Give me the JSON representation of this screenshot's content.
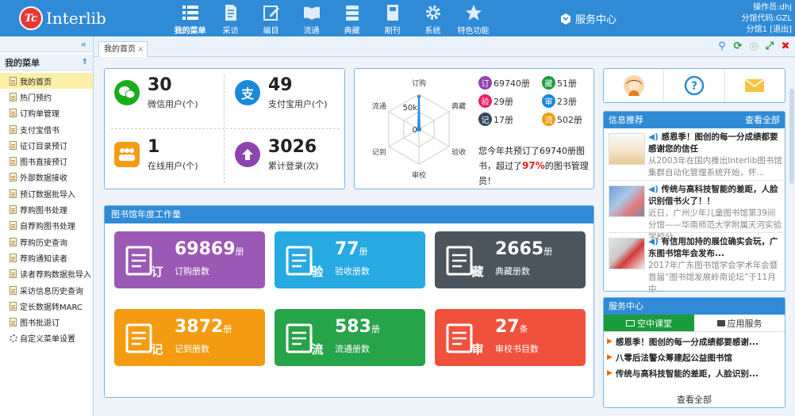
{
  "app": {
    "logo_mark": "Tc",
    "name": "Interlib"
  },
  "nav": [
    {
      "label": "我的菜单",
      "icon": "menu-list-icon",
      "active": true
    },
    {
      "label": "采访",
      "icon": "document-icon"
    },
    {
      "label": "编目",
      "icon": "edit-icon"
    },
    {
      "label": "流通",
      "icon": "book-open-icon"
    },
    {
      "label": "典藏",
      "icon": "archive-icon"
    },
    {
      "label": "期刊",
      "icon": "journal-icon"
    },
    {
      "label": "系统",
      "icon": "gear-icon"
    },
    {
      "label": "特色功能",
      "icon": "star-icon"
    }
  ],
  "service_center": "服务中心",
  "user": {
    "operator": "操作员:dhj",
    "branch_code": "分馆代码:GZL",
    "branch": "分馆1 [退出]"
  },
  "sidebar": {
    "collapse": "«",
    "title": "我的菜单",
    "toggle": "⇑",
    "items": [
      {
        "label": "我的首页",
        "active": true
      },
      {
        "label": "热门预约"
      },
      {
        "label": "订购单管理"
      },
      {
        "label": "支付宝借书"
      },
      {
        "label": "征订目录预订"
      },
      {
        "label": "图书直接预订"
      },
      {
        "label": "外部数据接收"
      },
      {
        "label": "预订数据批导入"
      },
      {
        "label": "荐购图书处理"
      },
      {
        "label": "自荐购图书处理"
      },
      {
        "label": "荐购历史查询"
      },
      {
        "label": "荐购通知读者"
      },
      {
        "label": "读者荐购数据批导入"
      },
      {
        "label": "采访信息历史查询"
      },
      {
        "label": "定长数据转MARC"
      },
      {
        "label": "图书批退订"
      },
      {
        "label": "自定义菜单设置",
        "icon": "gear"
      }
    ]
  },
  "tabs": [
    {
      "label": "我的首页",
      "close": "×"
    }
  ],
  "stats": [
    {
      "value": "30",
      "label": "微信用户(个)",
      "color": "#1aad19",
      "icon": "wechat-icon"
    },
    {
      "value": "49",
      "label": "支付宝用户(个)",
      "color": "#1a8ad8",
      "icon": "alipay-icon"
    },
    {
      "value": "1",
      "label": "在线用户(个)",
      "color": "#f39c12",
      "icon": "users-icon"
    },
    {
      "value": "3026",
      "label": "累计登录(次)",
      "color": "#8e44ad",
      "icon": "up-arrow-icon"
    }
  ],
  "radar": {
    "axes": [
      "订购",
      "典藏",
      "验收",
      "审校",
      "记到",
      "流通"
    ],
    "tick_labels": [
      "50k",
      "0"
    ],
    "values": [
      69740,
      51,
      29,
      23,
      17,
      502
    ]
  },
  "legend": [
    {
      "badge": "订",
      "value": "69740册",
      "color": "#8e44ad"
    },
    {
      "badge": "藏",
      "value": "51册",
      "color": "#1a9b3c"
    },
    {
      "badge": "验",
      "value": "29册",
      "color": "#e91e63"
    },
    {
      "badge": "审",
      "value": "23册",
      "color": "#1a8ad8"
    },
    {
      "badge": "记",
      "value": "17册",
      "color": "#34495e"
    },
    {
      "badge": "流",
      "value": "502册",
      "color": "#f39c12"
    }
  ],
  "summary": {
    "before": "您今年共预订了69740册图书，超过了",
    "pct": "97%",
    "after": "的图书管理员！"
  },
  "workload": {
    "title": "图书馆年度工作量",
    "tiles": [
      {
        "value": "69869",
        "unit": "册",
        "label": "订购册数",
        "color": "#9b59b6",
        "icon": "books-order-icon"
      },
      {
        "value": "77",
        "unit": "册",
        "label": "验收册数",
        "color": "#27a9e1",
        "icon": "chart-check-icon"
      },
      {
        "value": "2665",
        "unit": "册",
        "label": "典藏册数",
        "color": "#4a555d",
        "icon": "archive-doc-icon"
      },
      {
        "value": "3872",
        "unit": "册",
        "label": "记到册数",
        "color": "#f39c12",
        "icon": "book-record-icon"
      },
      {
        "value": "583",
        "unit": "册",
        "label": "流通册数",
        "color": "#27a34a",
        "icon": "globe-book-icon"
      },
      {
        "value": "27",
        "unit": "条",
        "label": "审校书目数",
        "color": "#f0513c",
        "icon": "review-icon"
      }
    ]
  },
  "quick_icons": [
    "avatar-icon",
    "help-icon",
    "mail-icon"
  ],
  "info": {
    "title": "信息推荐",
    "more": "查看全部",
    "items": [
      {
        "title": "感恩季！图创的每一分成绩都要感谢您的信任",
        "desc": "从2003年在国内推出Interlib图书馆集群自动化管理系统开始，怀..."
      },
      {
        "title": "传统与高科技智能的差距，人脸识别借书火了！！",
        "desc": "近日，广州少年儿童图书馆第39间分馆——华南师范大学附属天河实验学校分..."
      },
      {
        "title": "有信用加持的展位确实会玩，广东图书馆年会发布...",
        "desc": "2017年广东图书馆学会学术年会暨首届“图书馆发展岭南论坛”于11月中..."
      }
    ]
  },
  "service": {
    "title": "服务中心",
    "tabs": [
      {
        "label": "空中课堂",
        "active": true
      },
      {
        "label": "应用服务"
      }
    ],
    "items": [
      "感恩季！图创的每一分成绩都要感谢...",
      "八零后法警众筹建起公益图书馆",
      "传统与高科技智能的差距，人脸识别..."
    ],
    "more": "查看全部"
  }
}
